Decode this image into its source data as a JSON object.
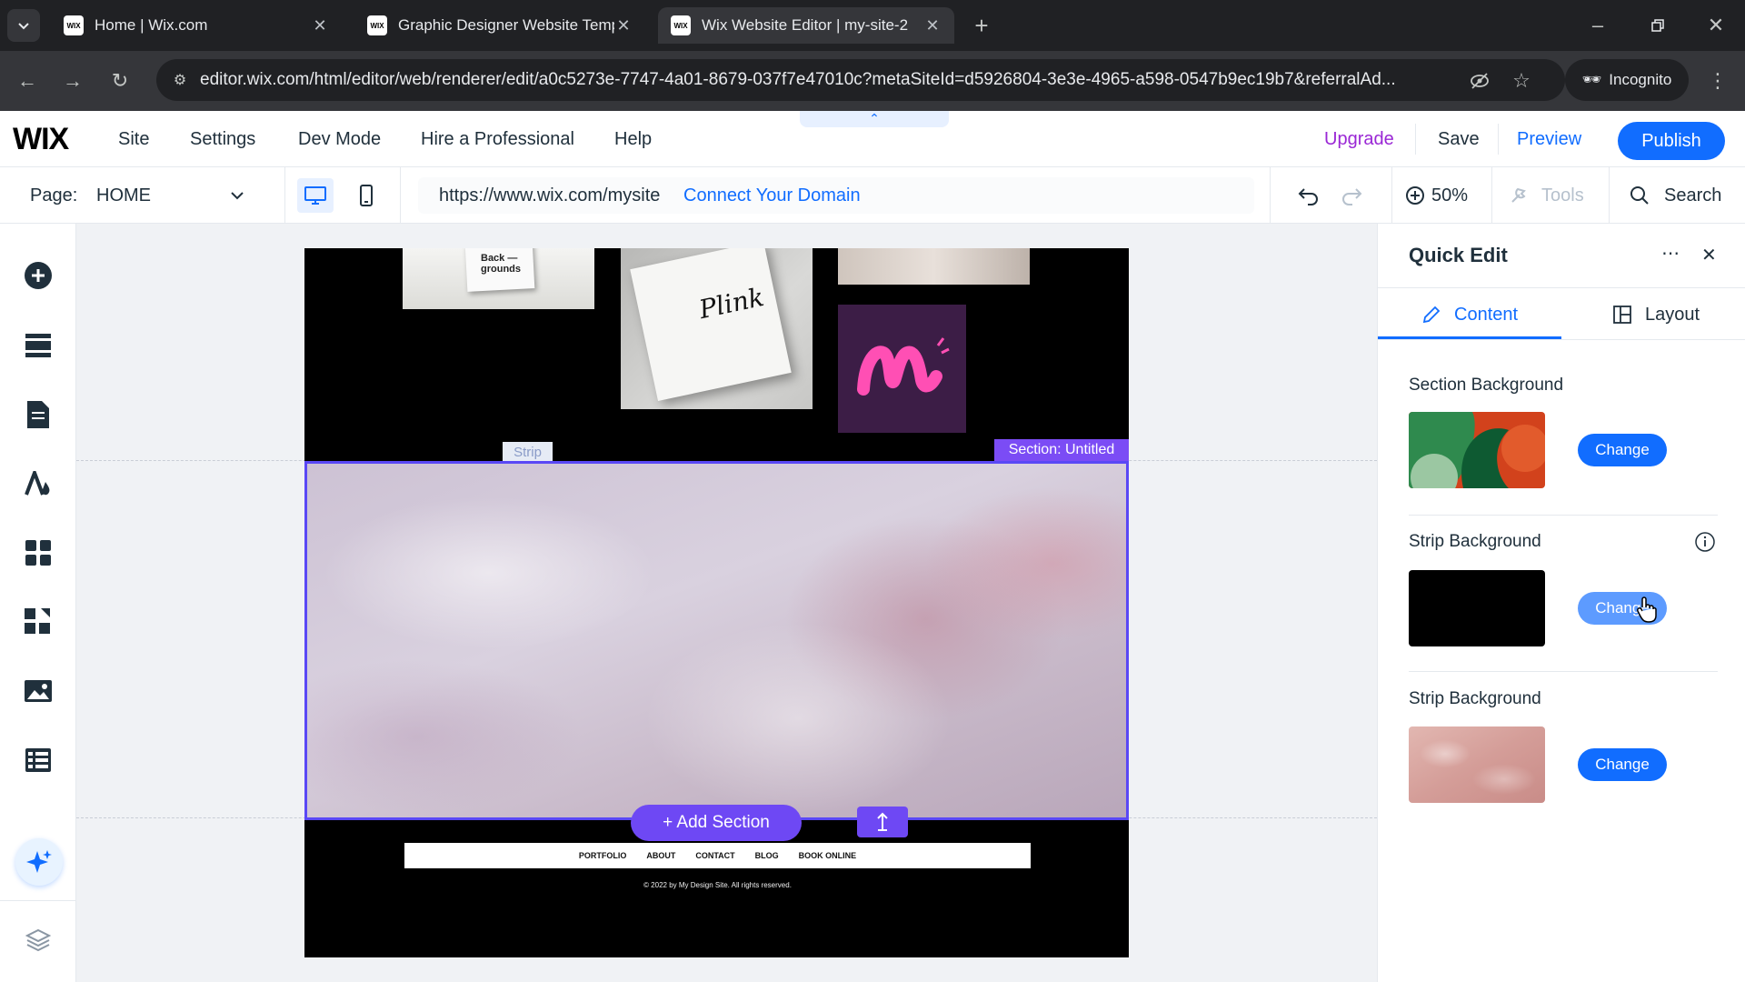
{
  "browser": {
    "tabs": [
      {
        "title": "Home | Wix.com",
        "favicon": "WIX"
      },
      {
        "title": "Graphic Designer Website Temp",
        "favicon": "WIX"
      },
      {
        "title": "Wix Website Editor | my-site-2",
        "favicon": "WIX"
      }
    ],
    "url": "editor.wix.com/html/editor/web/renderer/edit/a0c5273e-7747-4a01-8679-037f7e47010c?metaSiteId=d5926804-3e3e-4965-a598-0547b9ec19b7&referralAd...",
    "incognito_label": "Incognito"
  },
  "topbar": {
    "logo": "WIX",
    "menu": [
      "Site",
      "Settings",
      "Dev Mode",
      "Hire a Professional",
      "Help"
    ],
    "upgrade": "Upgrade",
    "save": "Save",
    "preview": "Preview",
    "publish": "Publish"
  },
  "pagebar": {
    "page_label": "Page:",
    "page_name": "HOME",
    "site_url": "https://www.wix.com/mysite",
    "connect_domain": "Connect Your Domain",
    "zoom": "50%",
    "tools": "Tools",
    "search": "Search"
  },
  "canvas": {
    "strip_label": "Strip",
    "section_label": "Section: Untitled",
    "add_section": "+ Add Section",
    "card_text_1": "Back — grounds",
    "card_text_2": "Plink",
    "footer_nav": [
      "PORTFOLIO",
      "ABOUT",
      "CONTACT",
      "BLOG",
      "BOOK ONLINE"
    ],
    "copyright": "© 2022 by My Design Site. All rights reserved."
  },
  "panel": {
    "title": "Quick Edit",
    "tab_content": "Content",
    "tab_layout": "Layout",
    "rows": [
      {
        "title": "Section Background",
        "button": "Change"
      },
      {
        "title": "Strip Background",
        "button": "Change"
      },
      {
        "title": "Strip Background",
        "button": "Change"
      }
    ]
  },
  "colors": {
    "accent": "#116dff",
    "upgrade": "#9a27d5",
    "selection": "#5a48f5"
  }
}
